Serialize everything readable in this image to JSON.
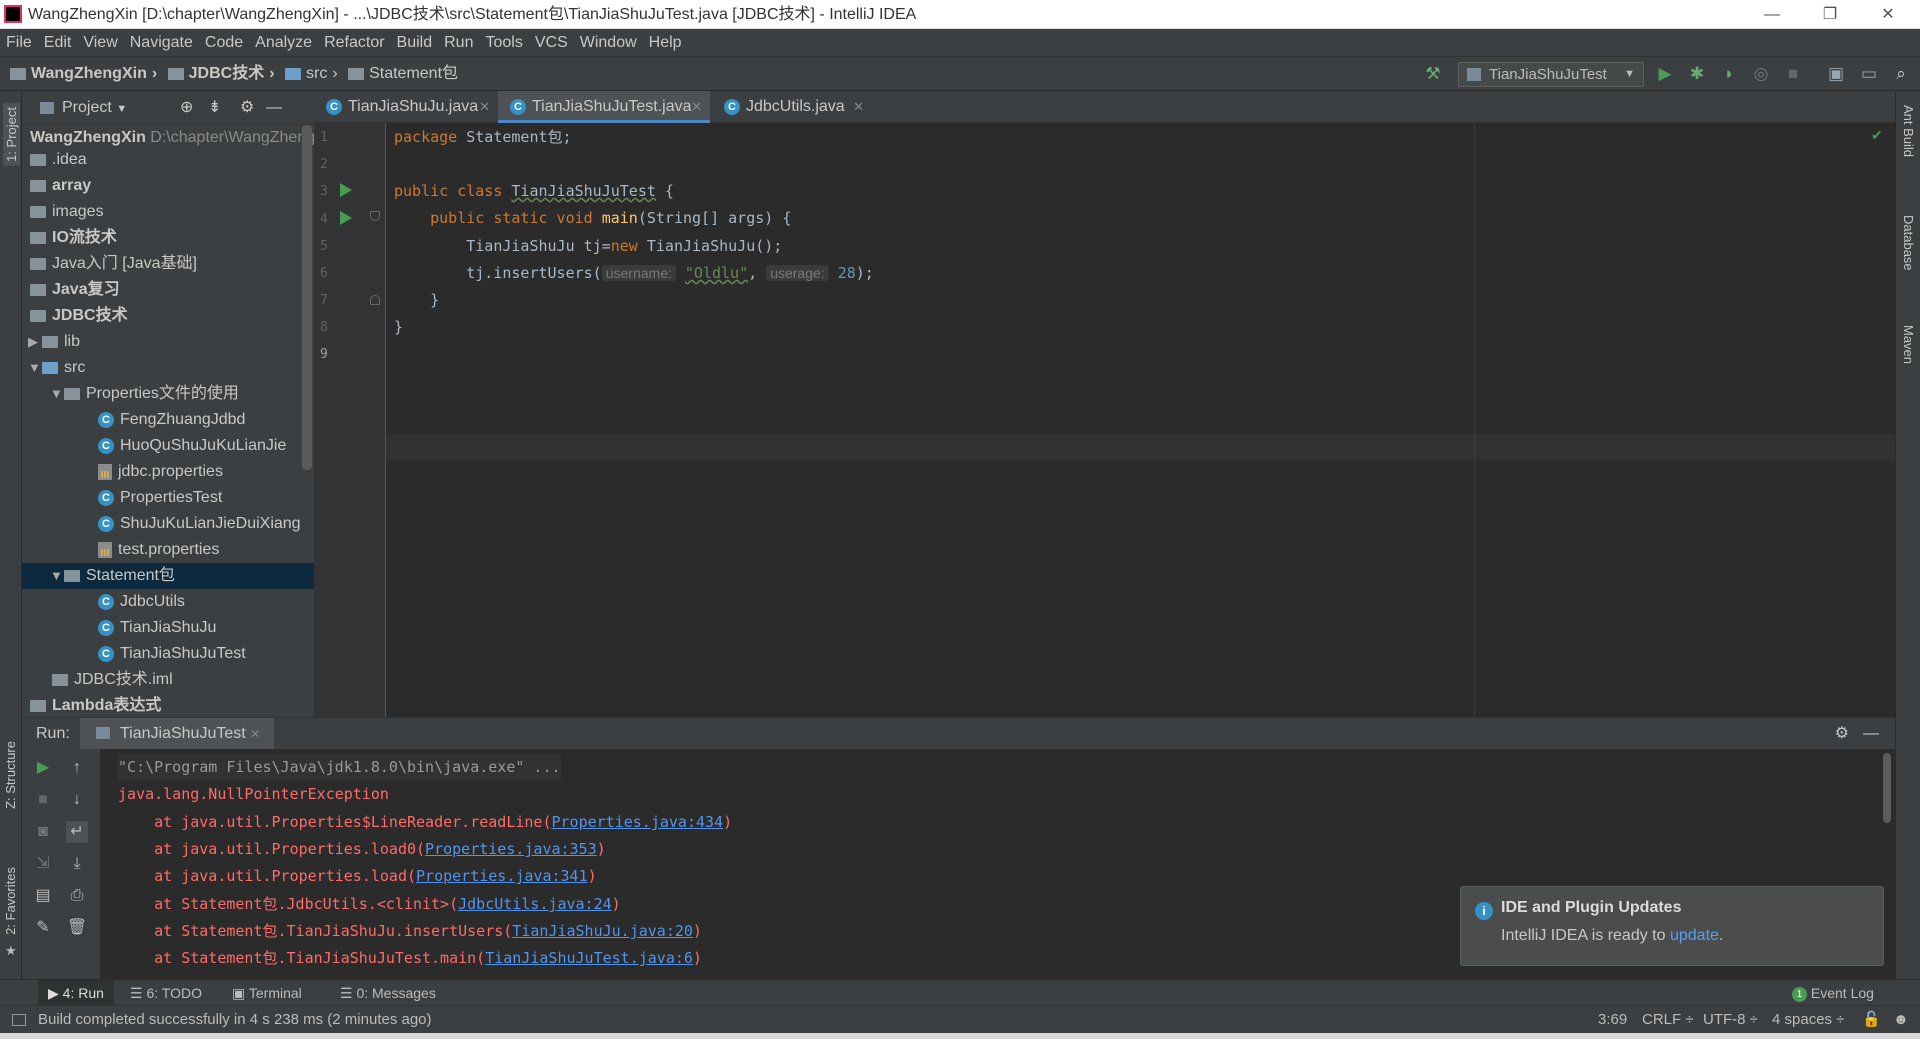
{
  "window": {
    "title": "WangZhengXin [D:\\chapter\\WangZhengXin] - ...\\JDBC技术\\src\\Statement包\\TianJiaShuJuTest.java [JDBC技术] - IntelliJ IDEA",
    "minimize_glyph": "—",
    "restore_glyph": "❐",
    "close_glyph": "✕"
  },
  "menu": [
    "File",
    "Edit",
    "View",
    "Navigate",
    "Code",
    "Analyze",
    "Refactor",
    "Build",
    "Run",
    "Tools",
    "VCS",
    "Window",
    "Help"
  ],
  "breadcrumb": [
    "WangZhengXin",
    "JDBC技术",
    "src",
    "Statement包"
  ],
  "toolbar": {
    "run_config": "TianJiaShuJuTest",
    "icons": [
      "hammer-icon",
      "run-icon",
      "debug-icon",
      "coverage-icon",
      "profile-icon",
      "stop-icon",
      "project-structure-icon",
      "sdk-icon",
      "search-icon"
    ]
  },
  "left_strip": {
    "project": "1: Project",
    "structure": "Z: Structure",
    "favorites": "2: Favorites"
  },
  "right_strip": {
    "ant": "Ant Build",
    "database": "Database",
    "maven": "Maven"
  },
  "project_panel": {
    "title": "Project",
    "root_name": "WangZhengXin",
    "root_path": "D:\\chapter\\WangZhengXin",
    "items": [
      {
        "label": "WangZhengXin",
        "extra": "D:\\chapter\\WangZhengXin",
        "type": "root"
      },
      {
        "label": ".idea",
        "type": "folder"
      },
      {
        "label": "array",
        "type": "module"
      },
      {
        "label": "images",
        "type": "folder"
      },
      {
        "label": "IO流技术",
        "type": "module"
      },
      {
        "label": "Java入门 [Java基础]",
        "type": "module"
      },
      {
        "label": "Java复习",
        "type": "module"
      },
      {
        "label": "JDBC技术",
        "type": "module"
      },
      {
        "label": "lib",
        "type": "folder"
      },
      {
        "label": "src",
        "type": "src"
      },
      {
        "label": "Properties文件的使用",
        "type": "package"
      },
      {
        "label": "FengZhuangJdbd",
        "type": "class"
      },
      {
        "label": "HuoQuShuJuKuLianJie",
        "type": "class"
      },
      {
        "label": "jdbc.properties",
        "type": "properties"
      },
      {
        "label": "PropertiesTest",
        "type": "class"
      },
      {
        "label": "ShuJuKuLianJieDuiXiang",
        "type": "class"
      },
      {
        "label": "test.properties",
        "type": "properties"
      },
      {
        "label": "Statement包",
        "type": "package"
      },
      {
        "label": "JdbcUtils",
        "type": "class"
      },
      {
        "label": "TianJiaShuJu",
        "type": "class"
      },
      {
        "label": "TianJiaShuJuTest",
        "type": "class"
      },
      {
        "label": "JDBC技术.iml",
        "type": "iml"
      },
      {
        "label": "Lambda表达式",
        "type": "module"
      }
    ]
  },
  "editor": {
    "tabs": [
      {
        "label": "TianJiaShuJu.java",
        "active": false
      },
      {
        "label": "TianJiaShuJuTest.java",
        "active": true
      },
      {
        "label": "JdbcUtils.java",
        "active": false
      }
    ],
    "line_numbers": [
      "1",
      "2",
      "3",
      "4",
      "5",
      "6",
      "7",
      "8",
      "9"
    ],
    "code": {
      "l1_kw": "package",
      "l1_rest": " Statement包;",
      "l3_kw": "public class",
      "l3_name": "TianJiaShuJuTest",
      "l3_rest": " {",
      "l4_kw": "public static void",
      "l4_fn": "main",
      "l4_rest": "(String[] args) {",
      "l5_a": "TianJiaShuJu tj=",
      "l5_kw": "new",
      "l5_b": " TianJiaShuJu();",
      "l6_a": "tj.insertUsers(",
      "l6_hint1": "username:",
      "l6_str": "\"Oldlu\"",
      "l6_comma": ",",
      "l6_hint2": "userage:",
      "l6_num": "28",
      "l6_end": ");",
      "l7": "}",
      "l8": "}"
    }
  },
  "run_panel": {
    "label": "Run:",
    "tab": "TianJiaShuJuTest",
    "console": {
      "cmd": "\"C:\\Program Files\\Java\\jdk1.8.0\\bin\\java.exe\" ...",
      "exception": "java.lang.NullPointerException",
      "frames": [
        {
          "text": "    at java.util.Properties$LineReader.readLine(",
          "link": "Properties.java:434",
          "end": ")"
        },
        {
          "text": "    at java.util.Properties.load0(",
          "link": "Properties.java:353",
          "end": ")"
        },
        {
          "text": "    at java.util.Properties.load(",
          "link": "Properties.java:341",
          "end": ")"
        },
        {
          "text": "    at Statement包.JdbcUtils.<clinit>(",
          "link": "JdbcUtils.java:24",
          "end": ")"
        },
        {
          "text": "    at Statement包.TianJiaShuJu.insertUsers(",
          "link": "TianJiaShuJu.java:20",
          "end": ")"
        },
        {
          "text": "    at Statement包.TianJiaShuJuTest.main(",
          "link": "TianJiaShuJuTest.java:6",
          "end": ")"
        }
      ]
    }
  },
  "notification": {
    "title": "IDE and Plugin Updates",
    "body": "IntelliJ IDEA is ready to",
    "link": "update",
    "end": "."
  },
  "bottom_tabs": {
    "run": "4: Run",
    "todo": "6: TODO",
    "terminal": "Terminal",
    "messages": "0: Messages",
    "event_log": "Event Log",
    "event_count": "1"
  },
  "status": {
    "message": "Build completed successfully in 4 s 238 ms (2 minutes ago)",
    "position": "3:69",
    "line_sep": "CRLF ÷",
    "encoding": "UTF-8 ÷",
    "indent": "4 spaces ÷"
  },
  "colors": {
    "keyword": "#cc7832",
    "string": "#6a8759",
    "number": "#6897bb",
    "error": "#ff6b68",
    "link": "#5394ec",
    "run_green": "#499c54"
  }
}
